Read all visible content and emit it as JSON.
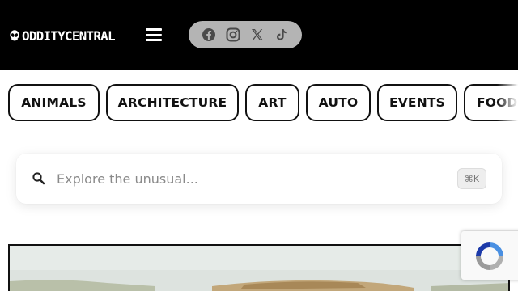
{
  "header": {
    "logo_text": "ODDITYCENTRAL",
    "logo_icon": "alien-head-icon",
    "menu_icon": "hamburger-menu-icon",
    "social_icons": [
      "facebook-icon",
      "instagram-icon",
      "x-icon",
      "tiktok-icon"
    ],
    "colors": {
      "background": "#000000",
      "social_pill": "#b4b4b4",
      "social_icon": "#4a4a4a"
    }
  },
  "categories": [
    {
      "label": "ANIMALS"
    },
    {
      "label": "ARCHITECTURE"
    },
    {
      "label": "ART"
    },
    {
      "label": "AUTO"
    },
    {
      "label": "EVENTS"
    },
    {
      "label": "FOOD"
    }
  ],
  "search": {
    "placeholder": "Explore the unusual...",
    "shortcut": "⌘K",
    "icon": "search-icon"
  },
  "hero": {
    "image": "featured-article-photo"
  },
  "recaptcha": {
    "icon": "recaptcha-icon"
  }
}
